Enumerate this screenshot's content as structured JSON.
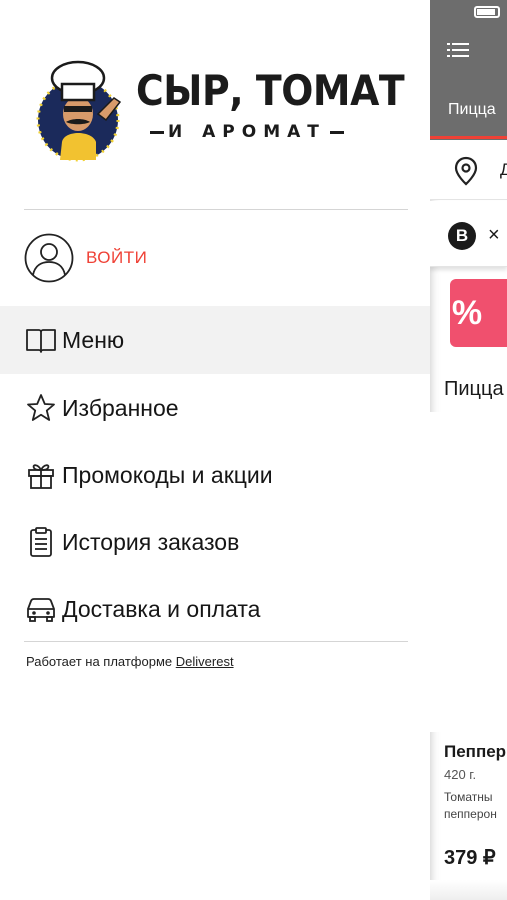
{
  "brand": {
    "name_line1": "СЫР, ТОМАТ",
    "name_line2": "И АРОМАТ"
  },
  "drawer": {
    "login_label": "ВОЙТИ",
    "menu_items": [
      {
        "label": "Меню",
        "icon": "book-icon",
        "active": true
      },
      {
        "label": "Избранное",
        "icon": "star-icon",
        "active": false
      },
      {
        "label": "Промокоды и акции",
        "icon": "gift-icon",
        "active": false
      },
      {
        "label": "История заказов",
        "icon": "clipboard-icon",
        "active": false
      },
      {
        "label": "Доставка и оплата",
        "icon": "car-icon",
        "active": false
      }
    ],
    "platform_prefix": "Работает на платформе",
    "platform_link": "Deliverest"
  },
  "background": {
    "tab_label": "Пицца",
    "address_text": "Д",
    "bonus_badge": "B",
    "bonus_text": "×",
    "promo_symbol": "%",
    "category_title": "Пицца",
    "product": {
      "name": "Пеппер",
      "weight": "420 г.",
      "desc_line1": "Томатны",
      "desc_line2": "пепперон",
      "price": "379 ₽"
    }
  },
  "colors": {
    "accent": "#ef4136",
    "promo": "#f0506e",
    "topbar": "#6d6d6d",
    "active_row": "#f2f2f2"
  }
}
